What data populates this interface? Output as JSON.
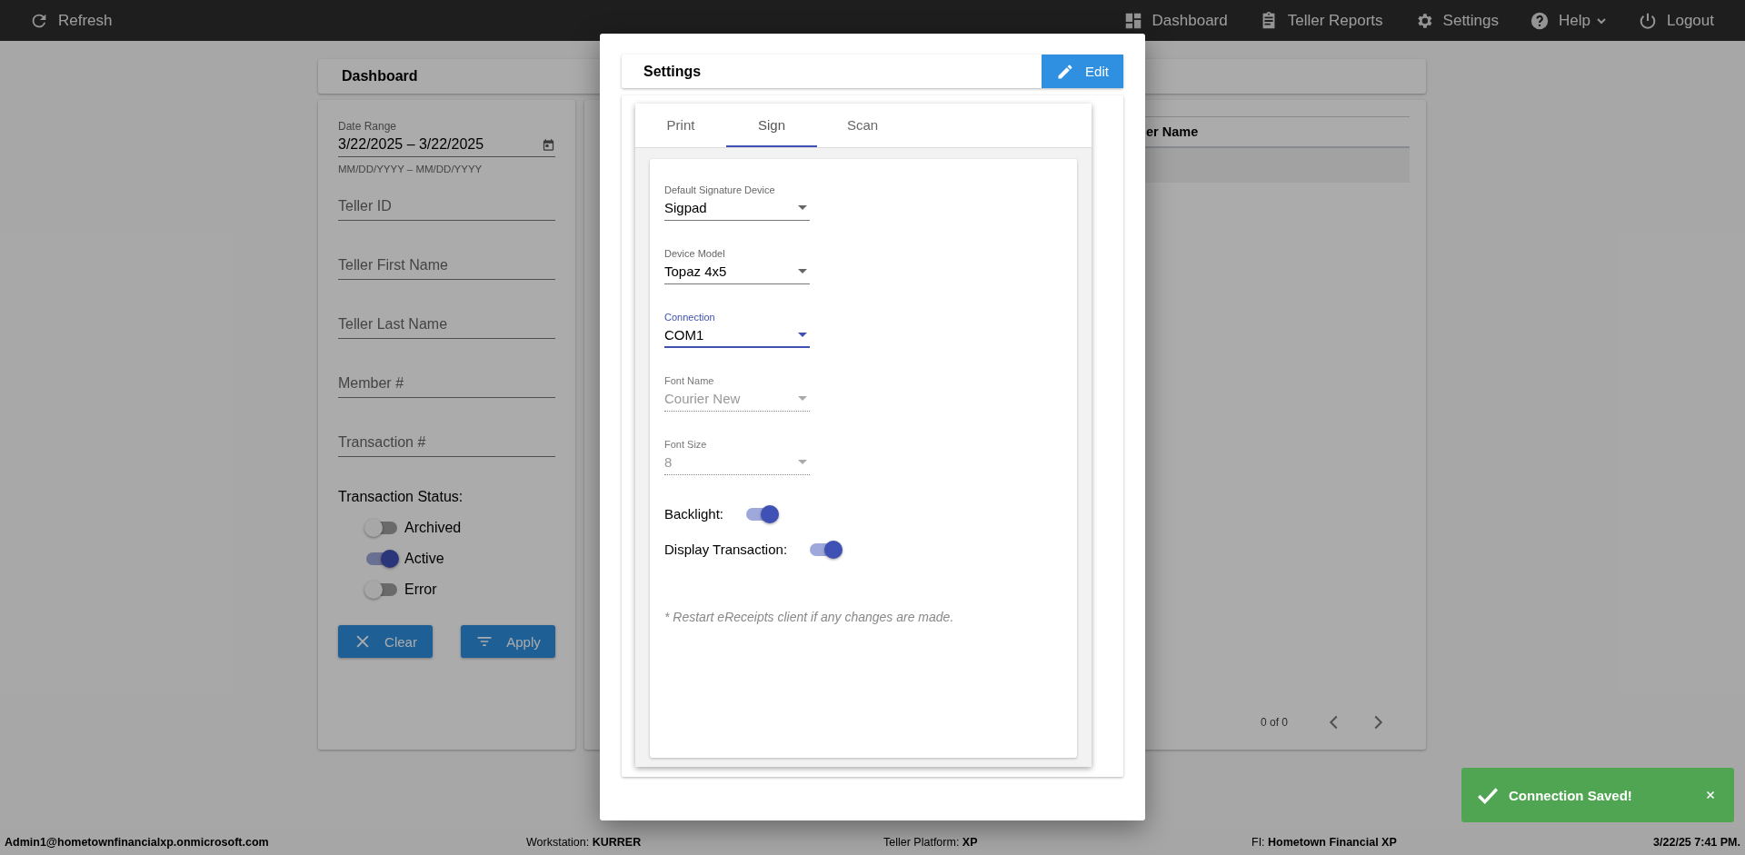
{
  "top_bar": {
    "refresh": "Refresh",
    "nav": [
      {
        "label": "Dashboard",
        "has_menu": false
      },
      {
        "label": "Teller Reports",
        "has_menu": false
      },
      {
        "label": "Settings",
        "has_menu": false
      },
      {
        "label": "Help",
        "has_menu": true
      },
      {
        "label": "Logout",
        "has_menu": false
      }
    ]
  },
  "page_title": "Dashboard",
  "filters": {
    "date_range": {
      "label": "Date Range",
      "value": "3/22/2025 – 3/22/2025",
      "hint": "MM/DD/YYYY – MM/DD/YYYY"
    },
    "fields": [
      {
        "placeholder": "Teller ID"
      },
      {
        "placeholder": "Teller First Name"
      },
      {
        "placeholder": "Teller Last Name"
      },
      {
        "placeholder": "Member #"
      },
      {
        "placeholder": "Transaction #"
      }
    ],
    "status": {
      "label": "Transaction Status:",
      "options": [
        {
          "label": "Archived",
          "on": false
        },
        {
          "label": "Active",
          "on": true
        },
        {
          "label": "Error",
          "on": false
        }
      ]
    },
    "buttons": [
      {
        "label": "Clear"
      },
      {
        "label": "Apply"
      }
    ]
  },
  "table": {
    "columns": [
      "er Name"
    ],
    "pagination": "0 of 0"
  },
  "modal": {
    "title": "Settings",
    "edit_button": "Edit",
    "tabs": [
      {
        "label": "Print",
        "selected": false
      },
      {
        "label": "Sign",
        "selected": true
      },
      {
        "label": "Scan",
        "selected": false
      }
    ],
    "fields": [
      {
        "label": "Default Signature Device",
        "value": "Sigpad",
        "focused": false,
        "disabled": false
      },
      {
        "label": "Device Model",
        "value": "Topaz 4x5",
        "focused": false,
        "disabled": false
      },
      {
        "label": "Connection",
        "value": "COM1",
        "focused": true,
        "disabled": false
      },
      {
        "label": "Font Name",
        "value": "Courier New",
        "focused": false,
        "disabled": true
      },
      {
        "label": "Font Size",
        "value": "8",
        "focused": false,
        "disabled": true
      }
    ],
    "switches": [
      {
        "label": "Backlight:",
        "on": true
      },
      {
        "label": "Display Transaction:",
        "on": true
      }
    ],
    "note": "* Restart eReceipts client if any changes are made."
  },
  "status_bar": {
    "user": "Admin1@hometownfinancialxp.onmicrosoft.com",
    "items": [
      "Workstation: **KURRER**",
      "Teller Platform: **XP**",
      "FI: **Hometown Financial XP**"
    ],
    "time": "3/22/25 7:41 PM."
  },
  "toast": {
    "message": "Connection Saved!"
  }
}
